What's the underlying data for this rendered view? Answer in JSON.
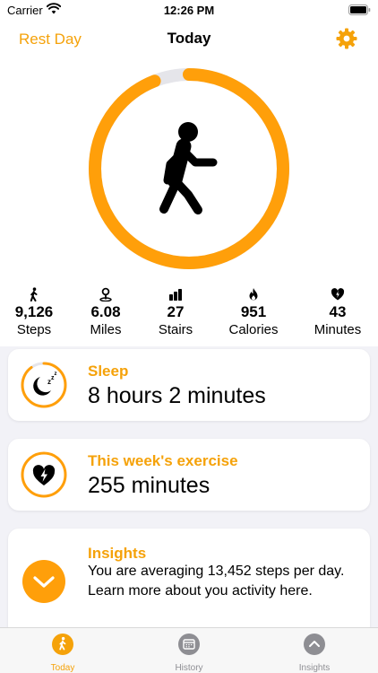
{
  "status_bar": {
    "carrier": "Carrier",
    "time": "12:26 PM"
  },
  "nav": {
    "left_button": "Rest Day",
    "title": "Today"
  },
  "ring": {
    "progress_fraction": 0.94,
    "color": "#FF9F0A",
    "track_color": "#E5E5EA"
  },
  "stats": [
    {
      "icon": "walking-icon",
      "value": "9,126",
      "label": "Steps"
    },
    {
      "icon": "location-pin-icon",
      "value": "6.08",
      "label": "Miles"
    },
    {
      "icon": "bar-chart-icon",
      "value": "27",
      "label": "Stairs"
    },
    {
      "icon": "flame-icon",
      "value": "951",
      "label": "Calories"
    },
    {
      "icon": "heart-bolt-icon",
      "value": "43",
      "label": "Minutes"
    }
  ],
  "cards": {
    "sleep": {
      "title": "Sleep",
      "value": "8 hours 2 minutes",
      "icon": "moon-zzz-icon",
      "ring_fraction": 0.9
    },
    "exercise": {
      "title": "This week's exercise",
      "value": "255 minutes",
      "icon": "heart-bolt-icon"
    },
    "insights": {
      "title": "Insights",
      "text": "You are averaging 13,452 steps per day. Learn more about you activity here.",
      "icon": "chevron-down-icon"
    }
  },
  "tabs": [
    {
      "label": "Today",
      "icon": "walking-icon",
      "active": true
    },
    {
      "label": "History",
      "icon": "calendar-icon",
      "active": false
    },
    {
      "label": "Insights",
      "icon": "chevron-up-icon",
      "active": false
    }
  ],
  "colors": {
    "accent": "#F5A20A",
    "inactive": "#8E8E93"
  }
}
